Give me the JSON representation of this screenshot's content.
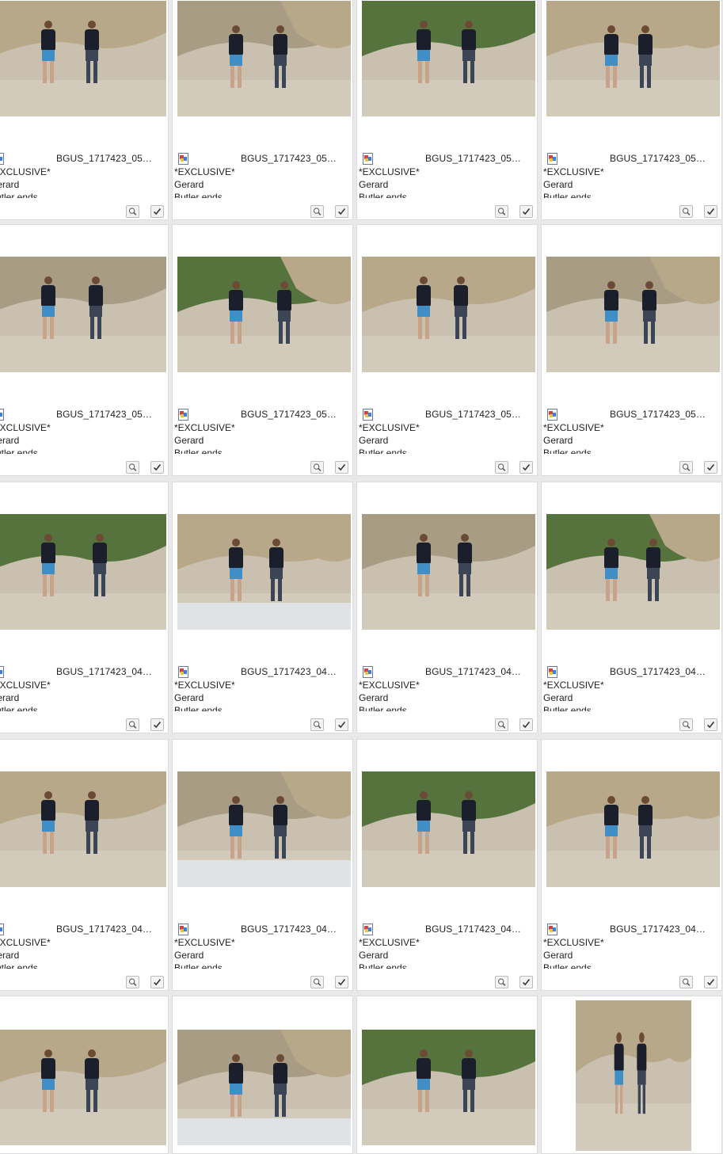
{
  "palette": {
    "sand": "#c9c0b0",
    "rock": "#b8a88a",
    "foliage": "#56723d",
    "shirt": "#1b1f2b",
    "shorts": "#3f8fc6",
    "water": "#dfe3e6"
  },
  "icons": {
    "file": "image-file-icon",
    "zoom": "magnifier-icon",
    "select": "checkmark-icon"
  },
  "rows": [
    {
      "filename": "BGUS_1717423_05…",
      "caption": [
        "*EXCLUSIVE*",
        "Gerard",
        "Butler ends"
      ]
    },
    {
      "filename": "BGUS_1717423_05…",
      "caption": [
        "*EXCLUSIVE*",
        "Gerard",
        "Butler ends"
      ]
    },
    {
      "filename": "BGUS_1717423_04…",
      "caption": [
        "*EXCLUSIVE*",
        "Gerard",
        "Butler ends"
      ]
    },
    {
      "filename": "BGUS_1717423_04…",
      "caption": [
        "*EXCLUSIVE*",
        "Gerard",
        "Butler ends"
      ]
    }
  ]
}
